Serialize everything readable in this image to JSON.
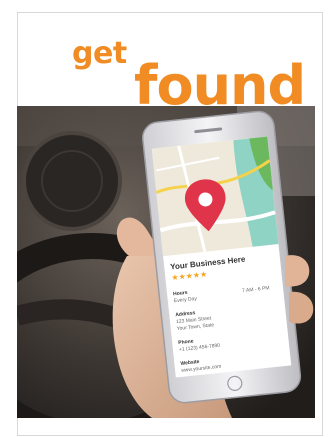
{
  "headline": {
    "small": "get",
    "large": "found"
  },
  "listing": {
    "business_name": "Your Business Here",
    "rating_stars": "★★★★★",
    "hours_label": "Hours",
    "hours_days": "Every Day",
    "hours_time": "7 AM - 6 PM",
    "address_label": "Address",
    "address_line1": "123 Main Street",
    "address_line2": "Your Town, State",
    "phone_label": "Phone",
    "phone_value": "+1 (123) 456-7890",
    "website_label": "Website",
    "website_value": "www.yoursite.com"
  },
  "colors": {
    "accent_orange": "#f08c23",
    "pin_red": "#e0344a",
    "star_orange": "#f5a623"
  }
}
